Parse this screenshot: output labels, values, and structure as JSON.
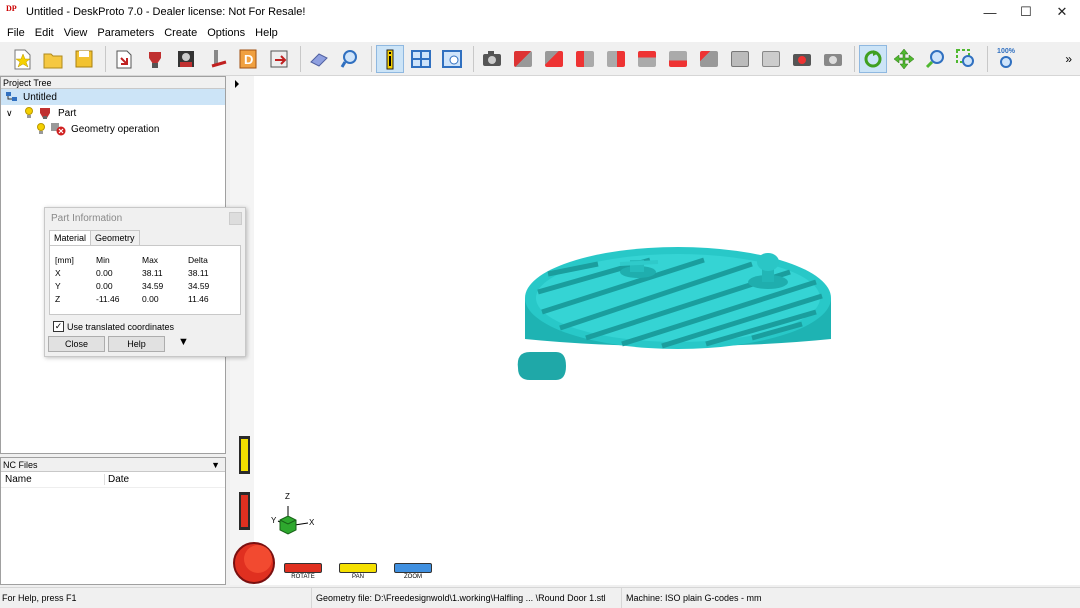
{
  "window": {
    "title": "Untitled - DeskProto 7.0 - Dealer license: Not For Resale!",
    "icon_text": "DP"
  },
  "menu": [
    "File",
    "Edit",
    "View",
    "Parameters",
    "Create",
    "Options",
    "Help"
  ],
  "toolbar": {
    "zoom_100_label": "100%",
    "overflow_label": "»"
  },
  "project_tree": {
    "header": "Project Tree",
    "root": "Untitled",
    "part": "Part",
    "geometry_op": "Geometry operation"
  },
  "nc_files": {
    "header": "NC Files",
    "col_name": "Name",
    "col_date": "Date"
  },
  "part_info": {
    "title": "Part Information",
    "tabs": [
      "Material",
      "Geometry"
    ],
    "headers": [
      "[mm]",
      "Min",
      "Max",
      "Delta"
    ],
    "rows": [
      [
        "X",
        "0.00",
        "38.11",
        "38.11"
      ],
      [
        "Y",
        "0.00",
        "34.59",
        "34.59"
      ],
      [
        "Z",
        "-11.46",
        "0.00",
        "11.46"
      ]
    ],
    "checkbox_label": "Use translated coordinates",
    "checkbox_checked": true,
    "close_label": "Close",
    "help_label": "Help"
  },
  "view_controls": {
    "rotate_label": "ROTATE",
    "pan_label": "PAN",
    "zoom_label": "ZOOM"
  },
  "axes": {
    "x": "X",
    "y": "Y",
    "z": "Z"
  },
  "model_color": "#2ec4c4",
  "status": {
    "help": "For Help, press F1",
    "geometry_file": "Geometry file: D:\\Freedesignwold\\1.working\\Halfling ... \\Round Door 1.stl",
    "machine": "Machine: ISO plain G-codes - mm"
  }
}
